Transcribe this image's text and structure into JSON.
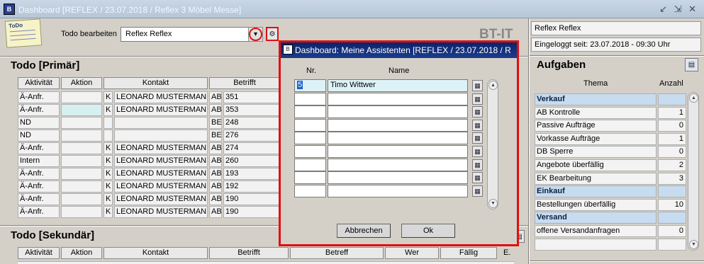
{
  "window": {
    "title": "Dashboard   [REFLEX / 23.07.2018 / Reflex 3 Möbel Messe]",
    "controls": "↙ ⇲ ✕"
  },
  "header": {
    "memo_text": "ToDo",
    "todo_label": "Todo bearbeiten",
    "todo_value": "Reflex Reflex",
    "brand": "BT-IT"
  },
  "right": {
    "user": "Reflex Reflex",
    "logged_in": "Eingeloggt seit: 23.07.2018 - 09:30 Uhr",
    "tasks_title": "Aufgaben",
    "col_topic": "Thema",
    "col_count": "Anzahl",
    "rows": [
      {
        "type": "group",
        "label": "Verkauf",
        "count": ""
      },
      {
        "type": "item",
        "label": "AB Kontrolle",
        "count": "1"
      },
      {
        "type": "item",
        "label": "Passive Aufträge",
        "count": "0"
      },
      {
        "type": "item",
        "label": "Vorkasse Aufträge",
        "count": "1"
      },
      {
        "type": "item",
        "label": "DB Sperre",
        "count": "0"
      },
      {
        "type": "item",
        "label": "Angebote überfällig",
        "count": "2"
      },
      {
        "type": "item",
        "label": "EK Bearbeitung",
        "count": "3"
      },
      {
        "type": "group",
        "label": "Einkauf",
        "count": ""
      },
      {
        "type": "item",
        "label": "Bestellungen überfällig",
        "count": "10"
      },
      {
        "type": "group",
        "label": "Versand",
        "count": ""
      },
      {
        "type": "item",
        "label": "offene Versandanfragen",
        "count": "0"
      },
      {
        "type": "item",
        "label": "",
        "count": ""
      }
    ]
  },
  "primary": {
    "title": "Todo [Primär]",
    "columns": [
      "Aktivität",
      "Aktion",
      "Kontakt",
      "Betrifft"
    ],
    "rows": [
      {
        "aktivitaet": "Ä-Anfr.",
        "aktion": "",
        "k": "K",
        "kontakt": "LEONARD MUSTERMANN",
        "typ": "AB",
        "nr": "351",
        "hl": false
      },
      {
        "aktivitaet": "Ä-Anfr.",
        "aktion": "",
        "k": "K",
        "kontakt": "LEONARD MUSTERMANN",
        "typ": "AB",
        "nr": "353",
        "hl": true
      },
      {
        "aktivitaet": "ND",
        "aktion": "",
        "k": "",
        "kontakt": "",
        "typ": "BE",
        "nr": "248",
        "hl": false
      },
      {
        "aktivitaet": "ND",
        "aktion": "",
        "k": "",
        "kontakt": "",
        "typ": "BE",
        "nr": "276",
        "hl": false
      },
      {
        "aktivitaet": "Ä-Anfr.",
        "aktion": "",
        "k": "K",
        "kontakt": "LEONARD MUSTERMANN",
        "typ": "AB",
        "nr": "274",
        "hl": false
      },
      {
        "aktivitaet": "Intern",
        "aktion": "",
        "k": "K",
        "kontakt": "LEONARD MUSTERMANN",
        "typ": "AB",
        "nr": "260",
        "hl": false
      },
      {
        "aktivitaet": "Ä-Anfr.",
        "aktion": "",
        "k": "K",
        "kontakt": "LEONARD MUSTERMANN",
        "typ": "AB",
        "nr": "193",
        "hl": false
      },
      {
        "aktivitaet": "Ä-Anfr.",
        "aktion": "",
        "k": "K",
        "kontakt": "LEONARD MUSTERMANN",
        "typ": "AB",
        "nr": "192",
        "hl": false
      },
      {
        "aktivitaet": "Ä-Anfr.",
        "aktion": "",
        "k": "K",
        "kontakt": "LEONARD MUSTERMANN",
        "typ": "AB",
        "nr": "190",
        "hl": false
      },
      {
        "aktivitaet": "Ä-Anfr.",
        "aktion": "",
        "k": "K",
        "kontakt": "LEONARD MUSTERMANN",
        "typ": "AB",
        "nr": "190",
        "hl": false
      }
    ]
  },
  "secondary": {
    "title": "Todo [Sekundär]",
    "columns": [
      "Aktivität",
      "Aktion",
      "Kontakt",
      "Betrifft",
      "Betreff",
      "Wer",
      "Fällig",
      "E."
    ]
  },
  "dialog": {
    "title": "Dashboard: Meine Assistenten   [REFLEX / 23.07.2018 / R",
    "col_nr": "Nr.",
    "col_name": "Name",
    "rows": [
      {
        "nr": "5",
        "name": "Timo Wittwer"
      },
      {
        "nr": "",
        "name": ""
      },
      {
        "nr": "",
        "name": ""
      },
      {
        "nr": "",
        "name": ""
      },
      {
        "nr": "",
        "name": ""
      },
      {
        "nr": "",
        "name": ""
      },
      {
        "nr": "",
        "name": ""
      },
      {
        "nr": "",
        "name": ""
      },
      {
        "nr": "",
        "name": ""
      }
    ],
    "cancel": "Abbrechen",
    "ok": "Ok"
  }
}
